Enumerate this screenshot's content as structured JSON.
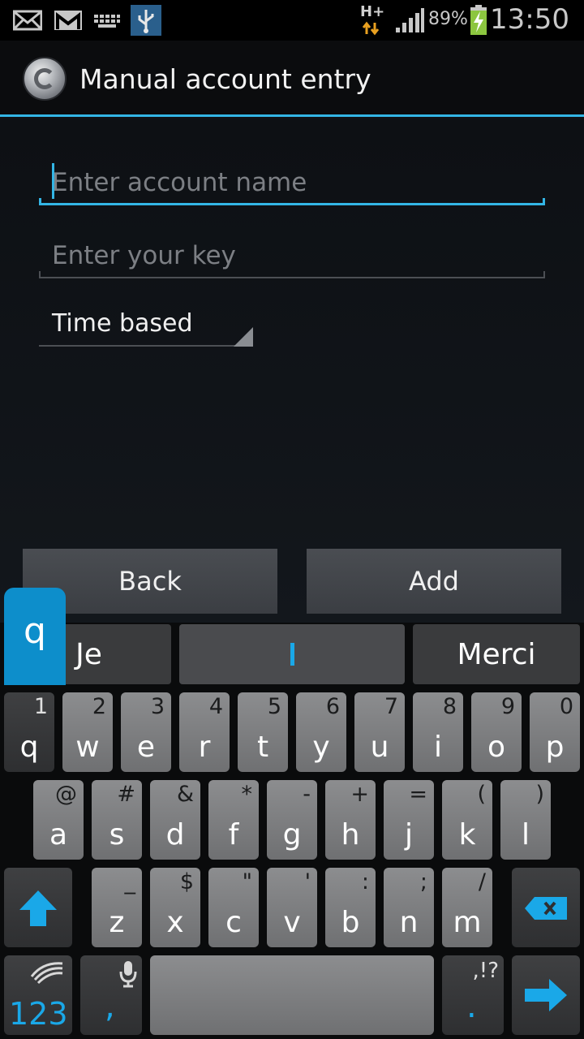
{
  "status_bar": {
    "time": "13:50",
    "battery_percent": "89%",
    "network_type": "H+",
    "icons": [
      "email-icon",
      "gmail-icon",
      "keyboard-icon",
      "usb-icon",
      "data-arrows-icon",
      "signal-icon",
      "battery-charging-icon"
    ]
  },
  "action_bar": {
    "title": "Manual account entry",
    "app_icon": "authenticator-icon"
  },
  "form": {
    "account_name_placeholder": "Enter account name",
    "key_placeholder": "Enter your key",
    "type_selected": "Time based",
    "back_label": "Back",
    "add_label": "Add"
  },
  "keyboard": {
    "predictions": [
      "Je",
      "",
      "Merci"
    ],
    "popup_key": "q",
    "row1": [
      {
        "main": "q",
        "alt": "1"
      },
      {
        "main": "w",
        "alt": "2"
      },
      {
        "main": "e",
        "alt": "3"
      },
      {
        "main": "r",
        "alt": "4"
      },
      {
        "main": "t",
        "alt": "5"
      },
      {
        "main": "y",
        "alt": "6"
      },
      {
        "main": "u",
        "alt": "7"
      },
      {
        "main": "i",
        "alt": "8"
      },
      {
        "main": "o",
        "alt": "9"
      },
      {
        "main": "p",
        "alt": "0"
      }
    ],
    "row2": [
      {
        "main": "a",
        "alt": "@"
      },
      {
        "main": "s",
        "alt": "#"
      },
      {
        "main": "d",
        "alt": "&"
      },
      {
        "main": "f",
        "alt": "*"
      },
      {
        "main": "g",
        "alt": "-"
      },
      {
        "main": "h",
        "alt": "+"
      },
      {
        "main": "j",
        "alt": "="
      },
      {
        "main": "k",
        "alt": "("
      },
      {
        "main": "l",
        "alt": ")"
      }
    ],
    "row3": [
      {
        "main": "z",
        "alt": "_"
      },
      {
        "main": "x",
        "alt": "$"
      },
      {
        "main": "c",
        "alt": "\""
      },
      {
        "main": "v",
        "alt": "'"
      },
      {
        "main": "b",
        "alt": ":"
      },
      {
        "main": "n",
        "alt": ";"
      },
      {
        "main": "m",
        "alt": "/"
      }
    ],
    "symbols_label": "123",
    "comma_label": ",",
    "punct_alt": ",!?",
    "punct_main": "."
  },
  "colors": {
    "accent": "#33b5e5",
    "popup": "#0d8ecb"
  }
}
